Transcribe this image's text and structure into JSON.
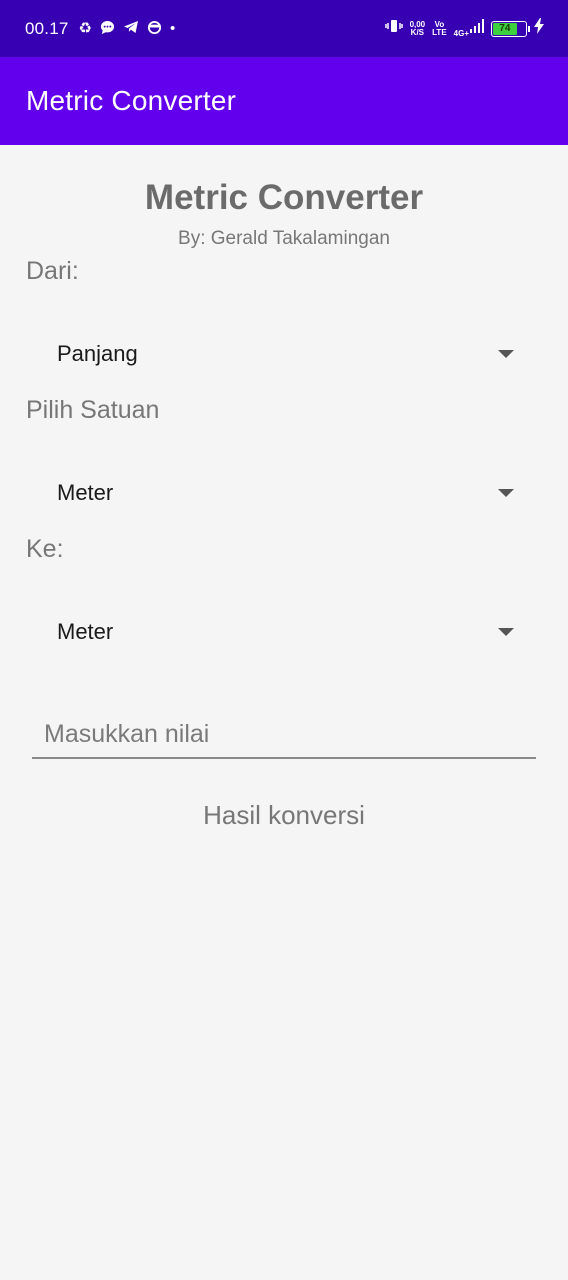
{
  "status_bar": {
    "time": "00.17",
    "left_icons": [
      "sync-icon",
      "chat-icon",
      "telegram-icon",
      "mask-icon",
      "dot-icon"
    ],
    "net_speed_value": "0,00",
    "net_speed_unit": "K/S",
    "volte_top": "Vo",
    "volte_bottom": "LTE",
    "network": "4G+",
    "battery_level": "74",
    "battery_percent": 74,
    "charging": true
  },
  "app_bar": {
    "title": "Metric Converter"
  },
  "main": {
    "heading": "Metric Converter",
    "byline": "By: Gerald Takalamingan",
    "from_label": "Dari:",
    "category_value": "Panjang",
    "unit_label": "Pilih Satuan",
    "from_unit_value": "Meter",
    "to_label": "Ke:",
    "to_unit_value": "Meter",
    "input_placeholder": "Masukkan nilai",
    "input_value": "",
    "result_text": "Hasil konversi"
  },
  "colors": {
    "status_bar": "#3700b3",
    "app_bar": "#6200ee",
    "background": "#f5f5f5",
    "battery": "#3ecf3e"
  }
}
